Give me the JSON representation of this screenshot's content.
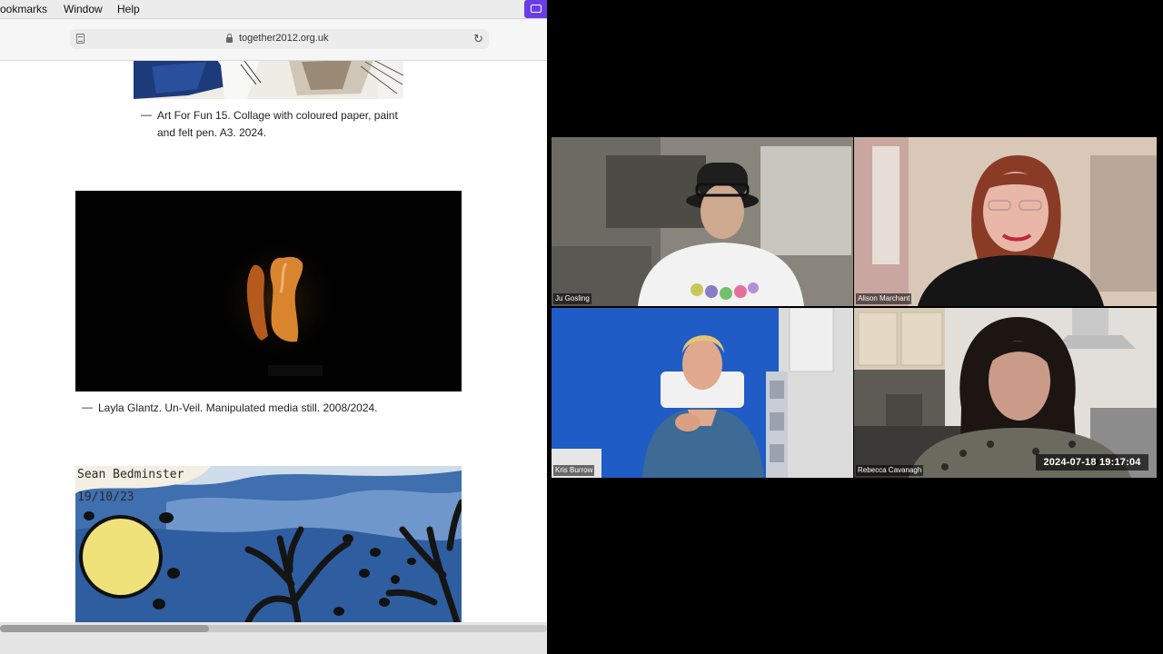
{
  "menubar": {
    "items": [
      "ookmarks",
      "Window",
      "Help"
    ]
  },
  "browser": {
    "url": "together2012.org.uk",
    "reader_icon": "reader-view-icon",
    "lock_icon": "lock-icon",
    "reload_icon": "reload-icon",
    "reload_glyph": "↻"
  },
  "page": {
    "captions": [
      {
        "dash": "—",
        "line1": "Art For Fun 15. Collage with coloured paper, paint",
        "line2": "and felt pen. A3. 2024."
      },
      {
        "dash": "—",
        "line1": "Layla Glantz. Un-Veil. Manipulated media still. 2008/2024.",
        "line2": ""
      }
    ],
    "artwork_signature": {
      "line1": "Sean Bedminster",
      "line2": "19/10/23"
    }
  },
  "participants": [
    {
      "name": "Ju Gosling"
    },
    {
      "name": "Alison Marchant"
    },
    {
      "name": "Kris Burrow"
    },
    {
      "name": "Rebecca Cavanagh"
    }
  ],
  "recording": {
    "timestamp": "2024-07-18  19:17:04"
  },
  "colors": {
    "app_accent": "#6a3de8",
    "menubar_bg": "#ececec",
    "video_background": "#000000"
  }
}
